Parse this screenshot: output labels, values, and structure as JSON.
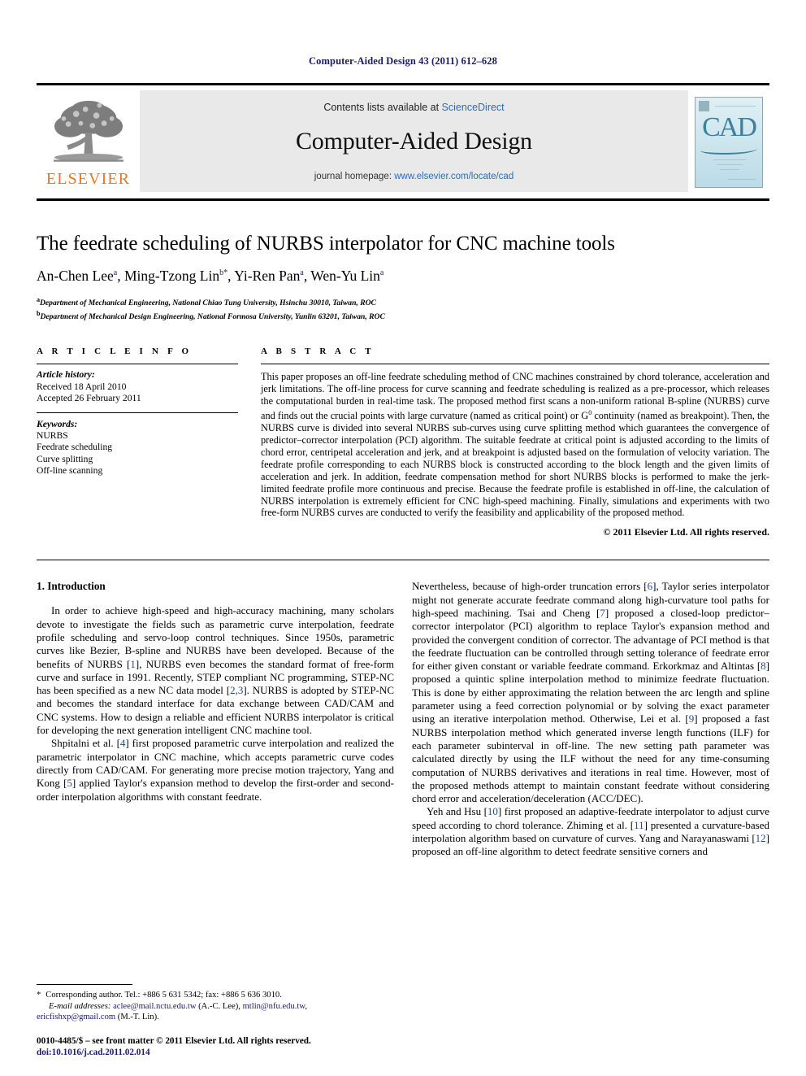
{
  "running_head": "Computer-Aided Design 43 (2011) 612–628",
  "masthead": {
    "publisher_name": "ELSEVIER",
    "contents_prefix": "Contents lists available at ",
    "contents_link": "ScienceDirect",
    "journal_title": "Computer-Aided Design",
    "homepage_prefix": "journal homepage: ",
    "homepage_link": "www.elsevier.com/locate/cad",
    "cover_label": "CAD"
  },
  "article": {
    "title": "The feedrate scheduling of NURBS interpolator for CNC machine tools",
    "authors": "An-Chen Lee a, Ming-Tzong Lin b*, Yi-Ren Pan a, Wen-Yu Lin a",
    "author_list": [
      {
        "name": "An-Chen Lee",
        "sup": "a"
      },
      {
        "name": "Ming-Tzong Lin",
        "sup": "b*"
      },
      {
        "name": "Yi-Ren Pan",
        "sup": "a"
      },
      {
        "name": "Wen-Yu Lin",
        "sup": "a"
      }
    ],
    "affiliations": [
      {
        "mark": "a",
        "text": "Department of Mechanical Engineering, National Chiao Tung University, Hsinchu 30010, Taiwan, ROC"
      },
      {
        "mark": "b",
        "text": "Department of Mechanical Design Engineering, National Formosa University, Yunlin 63201, Taiwan, ROC"
      }
    ]
  },
  "article_info": {
    "heading": "A R T I C L E   I N F O",
    "history_label": "Article history:",
    "received": "Received 18 April 2010",
    "accepted": "Accepted 26 February 2011",
    "keywords_label": "Keywords:",
    "keywords": [
      "NURBS",
      "Feedrate scheduling",
      "Curve splitting",
      "Off-line scanning"
    ]
  },
  "abstract": {
    "heading": "A B S T R A C T",
    "text": "This paper proposes an off-line feedrate scheduling method of CNC machines constrained by chord tolerance, acceleration and jerk limitations. The off-line process for curve scanning and feedrate scheduling is realized as a pre-processor, which releases the computational burden in real-time task. The proposed method first scans a non-uniform rational B-spline (NURBS) curve and finds out the crucial points with large curvature (named as critical point) or G0 continuity (named as breakpoint). Then, the NURBS curve is divided into several NURBS sub-curves using curve splitting method which guarantees the convergence of predictor–corrector interpolation (PCI) algorithm. The suitable feedrate at critical point is adjusted according to the limits of chord error, centripetal acceleration and jerk, and at breakpoint is adjusted based on the formulation of velocity variation. The feedrate profile corresponding to each NURBS block is constructed according to the block length and the given limits of acceleration and jerk. In addition, feedrate compensation method for short NURBS blocks is performed to make the jerk-limited feedrate profile more continuous and precise. Because the feedrate profile is established in off-line, the calculation of NURBS interpolation is extremely efficient for CNC high-speed machining. Finally, simulations and experiments with two free-form NURBS curves are conducted to verify the feasibility and applicability of the proposed method.",
    "copyright": "© 2011 Elsevier Ltd. All rights reserved."
  },
  "introduction": {
    "heading": "1. Introduction",
    "left_paragraphs": [
      "In order to achieve high-speed and high-accuracy machining, many scholars devote to investigate the fields such as parametric curve interpolation, feedrate profile scheduling and servo-loop control techniques. Since 1950s, parametric curves like Bezier, B-spline and NURBS have been developed. Because of the benefits of NURBS [1], NURBS even becomes the standard format of free-form curve and surface in 1991. Recently, STEP compliant NC programming, STEP-NC has been specified as a new NC data model [2,3]. NURBS is adopted by STEP-NC and becomes the standard interface for data exchange between CAD/CAM and CNC systems. How to design a reliable and efficient NURBS interpolator is critical for developing the next generation intelligent CNC machine tool.",
      "Shpitalni et al. [4] first proposed parametric curve interpolation and realized the parametric interpolator in CNC machine, which accepts parametric curve codes directly from CAD/CAM. For generating more precise motion trajectory, Yang and Kong [5] applied Taylor's expansion method to develop the first-order and second-order interpolation algorithms with constant feedrate."
    ],
    "right_paragraphs": [
      "Nevertheless, because of high-order truncation errors [6], Taylor series interpolator might not generate accurate feedrate command along high-curvature tool paths for high-speed machining. Tsai and Cheng [7] proposed a closed-loop predictor–corrector interpolator (PCI) algorithm to replace Taylor's expansion method and provided the convergent condition of corrector.  The advantage of PCI method is that the feedrate fluctuation can be controlled through setting tolerance of feedrate error for either given constant or variable feedrate command. Erkorkmaz and Altintas [8] proposed a quintic spline interpolation method to minimize feedrate fluctuation. This is done by either approximating the relation between the arc length and spline parameter using a feed correction polynomial or by solving the exact parameter using an iterative interpolation method. Otherwise, Lei et al. [9] proposed a fast NURBS interpolation method which generated inverse length functions (ILF) for each parameter subinterval in off-line. The new setting path parameter was calculated directly by using the ILF without the need for any time-consuming computation of NURBS derivatives and iterations in real time. However, most of the proposed methods attempt to maintain constant feedrate without considering chord error and acceleration/deceleration (ACC/DEC).",
      "Yeh and Hsu [10] first proposed an adaptive-feedrate interpolator to adjust curve speed according to chord tolerance. Zhiming et al. [11] presented a curvature-based interpolation algorithm based on curvature of curves. Yang and Narayanaswami [12] proposed an off-line algorithm to detect feedrate sensitive corners and"
    ]
  },
  "footnote": {
    "corresponding": "Corresponding author. Tel.: +886 5 631 5342; fax: +886 5 636 3010.",
    "email_label": "E-mail addresses:",
    "email_line1_a": "aclee@mail.nctu.edu.tw",
    "email_line1_b": " (A.-C. Lee), ",
    "email_line1_c": "mtlin@nfu.edu.tw",
    "email_line1_d": ",",
    "email_line2_a": "ericfishxp@gmail.com",
    "email_line2_b": " (M.-T. Lin)."
  },
  "imprint": {
    "issn_line": "0010-4485/$ – see front matter © 2011 Elsevier Ltd. All rights reserved.",
    "doi_line": "doi:10.1016/j.cad.2011.02.014"
  },
  "colors": {
    "running_head_blue": "#1a1a6e",
    "link_blue": "#2b6cb3",
    "ref_blue": "#1a4b9c",
    "elsevier_orange": "#E87722",
    "masthead_gray": "#e9e9e9",
    "cover_teal": "#3d7f9c"
  }
}
